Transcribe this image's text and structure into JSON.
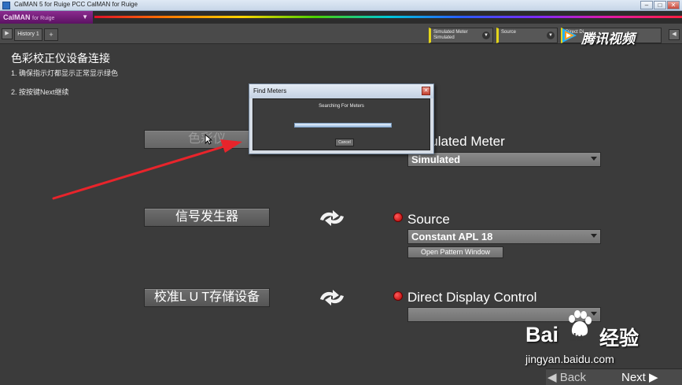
{
  "window": {
    "title": "CalMAN 5 for Ruige PCC CalMAN for Ruige",
    "minimize": "–",
    "maximize": "□",
    "close": "✕"
  },
  "brand": {
    "name": "CalMAN",
    "suffix": "for Ruige"
  },
  "tabs": {
    "history_tab": "History 1",
    "add_tab": "+",
    "left_nav": "▶",
    "right_nav_prev": "◀",
    "right_nav_next": "▶"
  },
  "device_selectors": [
    {
      "line1": "Simulated Meter",
      "line2": "Simulated"
    },
    {
      "line1": "Source",
      "line2": ""
    },
    {
      "line1": "Direct Di...",
      "line2": ""
    }
  ],
  "watermark_top": {
    "text": "腾讯视频"
  },
  "content": {
    "heading": "色彩校正仪设备连接",
    "step1": "1. 确保指示灯都显示正常显示绿色",
    "step2": "2. 按按键Next继续"
  },
  "rows": [
    {
      "button": "色彩仪",
      "device_label": "Simulated Meter",
      "select_value": "Simulated",
      "extra_button": ""
    },
    {
      "button": "信号发生器",
      "device_label": "Source",
      "select_value": "Constant APL 18",
      "extra_button": "Open Pattern Window"
    },
    {
      "button": "校准L U T存储设备",
      "device_label": "Direct Display Control",
      "select_value": "",
      "extra_button": ""
    }
  ],
  "dialog": {
    "title": "Find Meters",
    "message": "Searching For Meters",
    "progress": 1.0,
    "cancel": "Cancel",
    "close": "✕"
  },
  "nav": {
    "back": "◀ Back",
    "next": "Next ▶"
  },
  "watermark_bottom": {
    "bai": "Bai",
    "du": "du",
    "jingyan": "经验",
    "url": "jingyan.baidu.com"
  },
  "colors": {
    "status_red": "#d40000",
    "annotation_red": "#e8242b",
    "brand_purple": "#7a1d82"
  }
}
